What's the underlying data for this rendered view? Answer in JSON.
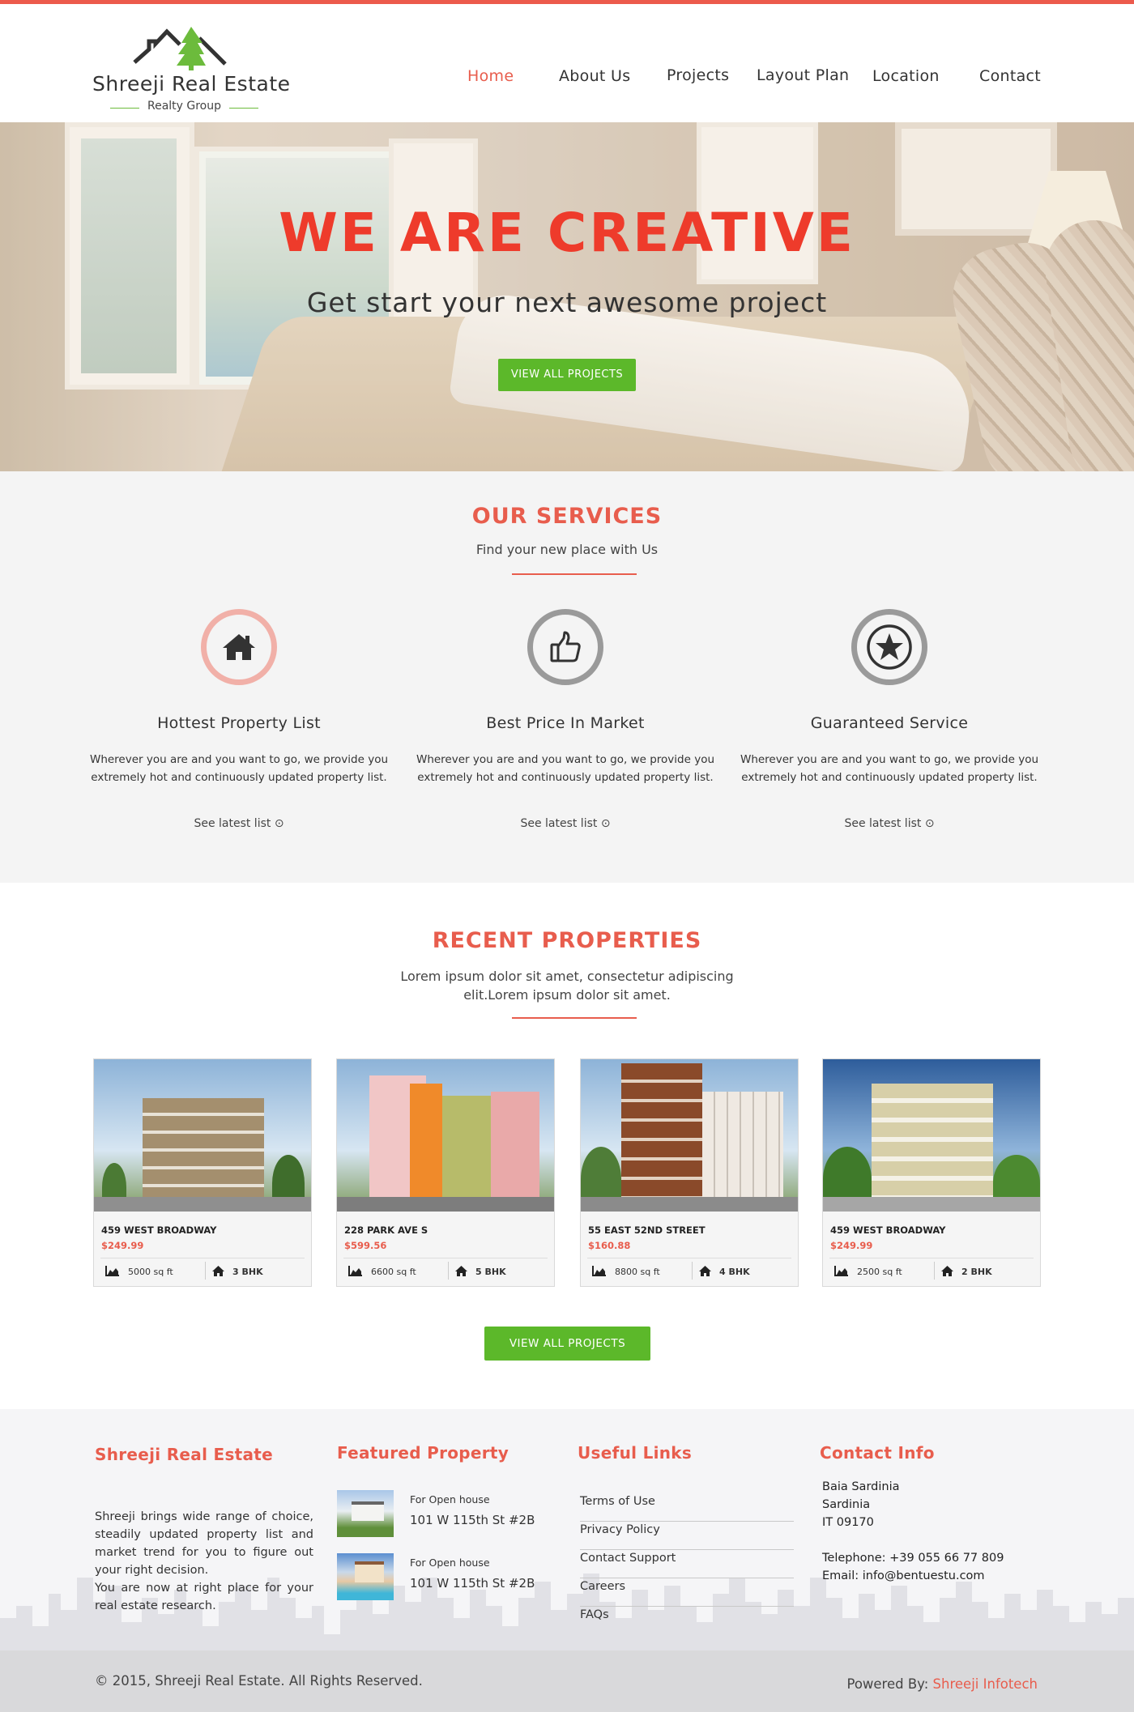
{
  "brand": {
    "name": "Shreeji Real Estate",
    "tagline": "Realty Group",
    "accent": "#e85d4d",
    "green": "#5cb82a"
  },
  "nav": {
    "items": [
      {
        "label": "Home",
        "active": true
      },
      {
        "label": "About Us"
      },
      {
        "label": "Projects"
      },
      {
        "label": "Layout Plan"
      },
      {
        "label": "Location"
      },
      {
        "label": "Contact"
      }
    ]
  },
  "hero": {
    "title": "WE ARE CREATIVE",
    "subtitle": "Get start your next awesome project",
    "button": "VIEW ALL PROJECTS"
  },
  "services": {
    "title": "OUR SERVICES",
    "subtitle": "Find your new place with Us",
    "items": [
      {
        "icon": "home-icon",
        "title": "Hottest Property List",
        "text": "Wherever you are and you want to go, we provide you extremely hot and continuously updated property list.",
        "link": "See latest list"
      },
      {
        "icon": "thumbs-up-icon",
        "title": "Best Price In Market",
        "text": "Wherever you are and you want to go, we provide you extremely hot and continuously updated property list.",
        "link": "See latest list"
      },
      {
        "icon": "star-icon",
        "title": "Guaranteed Service",
        "text": "Wherever you are and you want to go, we provide you extremely hot and continuously updated property list.",
        "link": "See latest list"
      }
    ]
  },
  "recent": {
    "title": "RECENT PROPERTIES",
    "subtitle_line1": "Lorem ipsum dolor sit amet, consectetur adipiscing",
    "subtitle_line2": "elit.Lorem ipsum dolor sit amet.",
    "properties": [
      {
        "address": "459 WEST BROADWAY",
        "price": "$249.99",
        "area": "5000 sq ft",
        "bhk": "3 BHK"
      },
      {
        "address": "228 PARK AVE S",
        "price": "$599.56",
        "area": "6600 sq ft",
        "bhk": "5 BHK"
      },
      {
        "address": "55 EAST 52ND STREET",
        "price": "$160.88",
        "area": "8800 sq ft",
        "bhk": "4 BHK"
      },
      {
        "address": "459 WEST BROADWAY",
        "price": "$249.99",
        "area": "2500 sq ft",
        "bhk": "2 BHK"
      }
    ],
    "button": "VIEW ALL PROJECTS"
  },
  "footer": {
    "about": {
      "title": "Shreeji Real Estate",
      "p1": "Shreeji brings wide range of choice, steadily updated property list and market trend for you to figure out your right decision.",
      "p2": "You are now at right place for your real estate research."
    },
    "featured": {
      "title": "Featured Property",
      "items": [
        {
          "label": "For Open house",
          "address": "101 W 115th St #2B"
        },
        {
          "label": "For Open house",
          "address": "101 W 115th St #2B"
        }
      ]
    },
    "links": {
      "title": "Useful Links",
      "items": [
        "Terms of Use",
        "Privacy Policy",
        "Contact Support",
        "Careers",
        "FAQs"
      ]
    },
    "contact": {
      "title": "Contact Info",
      "line1": "Baia Sardinia",
      "line2": "Sardinia",
      "line3": "IT 09170",
      "phone": "Telephone: +39 055 66 77 809",
      "email": "Email: info@bentuestu.com"
    }
  },
  "bottom": {
    "copyright": "© 2015, Shreeji Real Estate. All Rights Reserved.",
    "powered_label": "Powered By:",
    "powered_name": "Shreeji Infotech"
  }
}
